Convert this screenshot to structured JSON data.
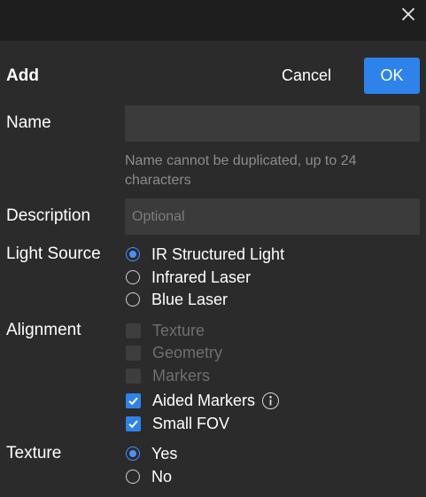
{
  "dialog": {
    "title": "Add",
    "cancel_label": "Cancel",
    "ok_label": "OK"
  },
  "name": {
    "label": "Name",
    "value": "",
    "placeholder": "",
    "hint": "Name cannot be duplicated, up to 24 characters"
  },
  "description": {
    "label": "Description",
    "value": "",
    "placeholder": "Optional"
  },
  "light_source": {
    "label": "Light Source",
    "options": [
      {
        "label": "IR Structured Light",
        "selected": true
      },
      {
        "label": "Infrared Laser",
        "selected": false
      },
      {
        "label": "Blue Laser",
        "selected": false
      }
    ]
  },
  "alignment": {
    "label": "Alignment",
    "options": [
      {
        "label": "Texture",
        "checked": false,
        "enabled": false
      },
      {
        "label": "Geometry",
        "checked": false,
        "enabled": false
      },
      {
        "label": "Markers",
        "checked": false,
        "enabled": false
      },
      {
        "label": "Aided Markers",
        "checked": true,
        "enabled": true
      },
      {
        "label": "Small FOV",
        "checked": true,
        "enabled": true
      }
    ]
  },
  "texture": {
    "label": "Texture",
    "options": [
      {
        "label": "Yes",
        "selected": true
      },
      {
        "label": "No",
        "selected": false
      }
    ]
  },
  "colors": {
    "accent": "#2d83ea",
    "background": "#2b2b2b",
    "titlebar": "#1e1e1e",
    "field": "#3b3b3b"
  },
  "icons": {
    "close": "close-icon",
    "info": "info-icon",
    "check": "check-icon"
  }
}
